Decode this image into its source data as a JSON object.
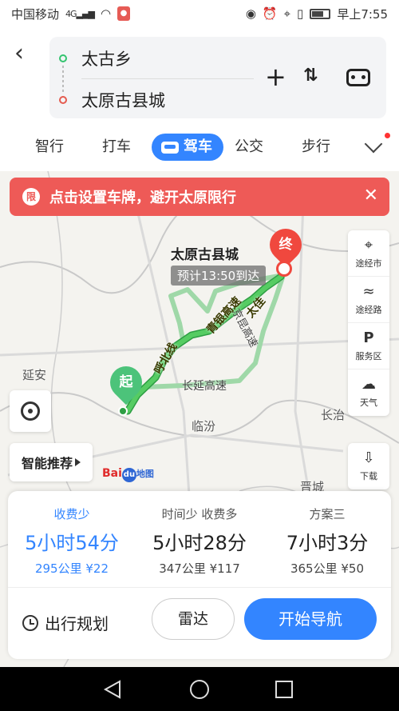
{
  "status_bar": {
    "carrier": "中国移动",
    "network": "4G",
    "time": "早上7:55"
  },
  "route": {
    "origin": "太古乡",
    "destination": "太原古县城"
  },
  "modes": [
    {
      "label": "智行"
    },
    {
      "label": "打车"
    },
    {
      "label": "驾车",
      "active": true
    },
    {
      "label": "公交"
    },
    {
      "label": "步行"
    }
  ],
  "alert": {
    "icon_text": "限",
    "message": "点击设置车牌，避开太原限行"
  },
  "map": {
    "dest_label": "太原古县城",
    "eta": "预计13:50到达",
    "start_pin": "起",
    "end_pin": "终",
    "place_labels": [
      "延安",
      "临汾",
      "长治",
      "晋城"
    ],
    "road_labels": [
      "长延高速",
      "京昆高速",
      "青银高速",
      "呼北线",
      "太佳"
    ],
    "tools": [
      {
        "icon": "map-pin-icon",
        "label": "途经市"
      },
      {
        "icon": "route-icon",
        "label": "途经路"
      },
      {
        "icon": "parking-icon",
        "label": "服务区"
      },
      {
        "icon": "cloud-icon",
        "label": "天气"
      }
    ],
    "download_label": "下载",
    "smart_label": "智能推荐",
    "logo_text": "Bai",
    "logo_du": "du",
    "logo_map": "地图"
  },
  "plans": [
    {
      "tag": "收费少",
      "time": "5小时54分",
      "distance": "295公里",
      "fee": "¥22",
      "selected": true
    },
    {
      "tag": "时间少  收费多",
      "time": "5小时28分",
      "distance": "347公里",
      "fee": "¥117"
    },
    {
      "tag": "方案三",
      "time": "7小时3分",
      "distance": "365公里",
      "fee": "¥50"
    }
  ],
  "actions": {
    "trip_plan": "出行规划",
    "radar": "雷达",
    "start_nav": "开始导航"
  },
  "colors": {
    "accent": "#3385ff",
    "alert": "#ee5a57",
    "route_green": "#3dbd5d"
  }
}
